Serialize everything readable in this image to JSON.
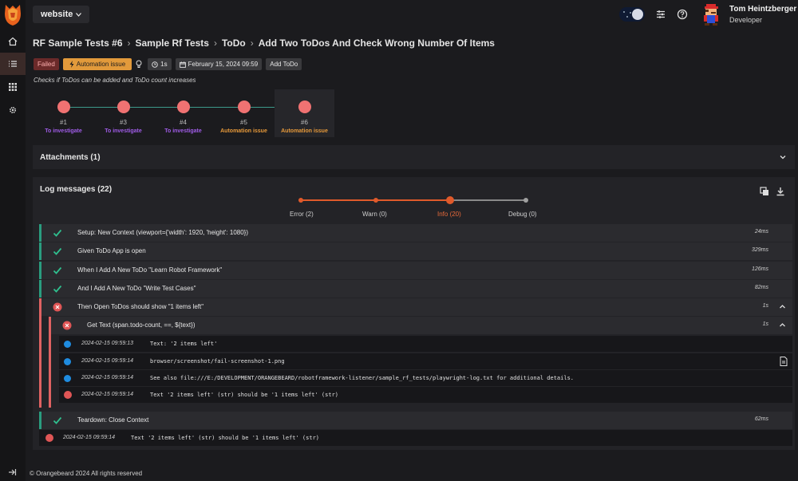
{
  "app": {
    "project": "website",
    "user": {
      "name": "Tom Heintzberger",
      "role": "Developer"
    }
  },
  "breadcrumb": [
    "RF Sample Tests #6",
    "Sample Rf Tests",
    "ToDo",
    "Add Two ToDos And Check Wrong Number Of Items"
  ],
  "tags": {
    "status": "Failed",
    "defect": "Automation issue",
    "duration": "1s",
    "date": "February 15, 2024 09:59",
    "attribute": "Add ToDo"
  },
  "description": "Checks if ToDos can be added and ToDo count increases",
  "history": [
    {
      "num": "#1",
      "status": "To investigate"
    },
    {
      "num": "#3",
      "status": "To investigate"
    },
    {
      "num": "#4",
      "status": "To investigate"
    },
    {
      "num": "#5",
      "status": "Automation issue"
    },
    {
      "num": "#6",
      "status": "Automation issue"
    }
  ],
  "attachments": {
    "title": "Attachments (1)"
  },
  "logs": {
    "title": "Log messages (22)",
    "levels": [
      "Error (2)",
      "Warn (0)",
      "Info (20)",
      "Debug (0)"
    ],
    "selected_level": "Info (20)",
    "steps": [
      {
        "label": "Setup: New Context (viewport={'width': 1920, 'height': 1080})",
        "duration": "24ms"
      },
      {
        "label": "Given ToDo App is open",
        "duration": "329ms"
      },
      {
        "label": "When I Add A New ToDo \"Learn Robot Framework\"",
        "duration": "126ms"
      },
      {
        "label": "And I Add A New ToDo \"Write Test Cases\"",
        "duration": "82ms"
      },
      {
        "label": "Then Open ToDos should show \"1 items left\"",
        "duration": "1s"
      },
      {
        "label": "Get Text (span.todo-count, ==, ${text})",
        "duration": "1s"
      },
      {
        "label": "Teardown: Close Context",
        "duration": "62ms"
      }
    ],
    "lines": [
      {
        "ts": "2024-02-15 09:59:13",
        "msg": "Text: '2 items left'"
      },
      {
        "ts": "2024-02-15 09:59:14",
        "msg": "browser/screenshot/fail-screenshot-1.png"
      },
      {
        "ts": "2024-02-15 09:59:14",
        "msg": "See also file:///E:/DEVELOPMENT/ORANGEBEARD/robotframework-listener/sample_rf_tests/playwright-log.txt for additional details."
      },
      {
        "ts": "2024-02-15 09:59:14",
        "msg": "Text '2 items left' (str) should be '1 items left' (str)"
      }
    ],
    "final": {
      "ts": "2024-02-15 09:59:14",
      "msg": "Text '2 items left' (str) should be '1 items left' (str)"
    }
  },
  "footer": "© Orangebeard 2024 All rights reserved",
  "colors": {
    "accent": "#e05a2b",
    "pass": "#2a9d7f",
    "fail": "#e06262",
    "info": "#1f8ce0",
    "issue": "#e29a3b",
    "investigate": "#a05ce8"
  }
}
